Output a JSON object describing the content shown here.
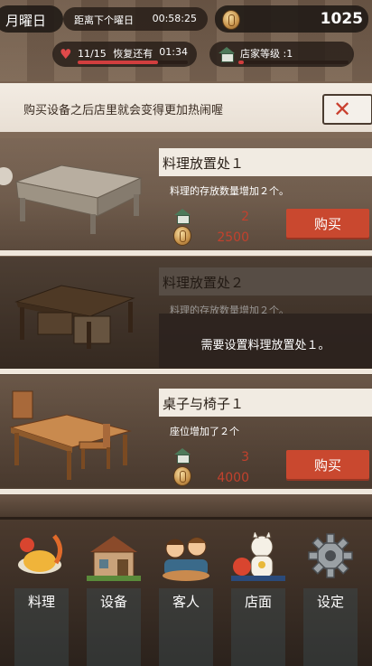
{
  "status_bar": {
    "day": "月曜日",
    "next_day_label": "距离下个曜日",
    "next_day_time": "00:58:25",
    "coins": "1025",
    "stamina": "11/15",
    "recover_label": "恢复还有",
    "recover_time": "01:34",
    "stamina_fraction": 0.73,
    "rank_label": "店家等级 :1",
    "rank_fraction": 0.05
  },
  "notice": {
    "text": "购买设备之后店里就会变得更加热闹喔"
  },
  "items": [
    {
      "title": "料理放置处１",
      "desc": "料理的存放数量增加２个。",
      "rank_req": "2",
      "price": "2500",
      "buy_label": "购买"
    },
    {
      "title": "料理放置处２",
      "desc": "料理的存放数量增加２个。",
      "lock_text": "需要设置料理放置处１。"
    },
    {
      "title": "桌子与椅子１",
      "desc": "座位增加了２个",
      "rank_req": "3",
      "price": "4000",
      "buy_label": "购买"
    }
  ],
  "nav": {
    "cooking": "料理",
    "equipment": "设备",
    "customers": "客人",
    "storefront": "店面",
    "settings": "设定"
  }
}
